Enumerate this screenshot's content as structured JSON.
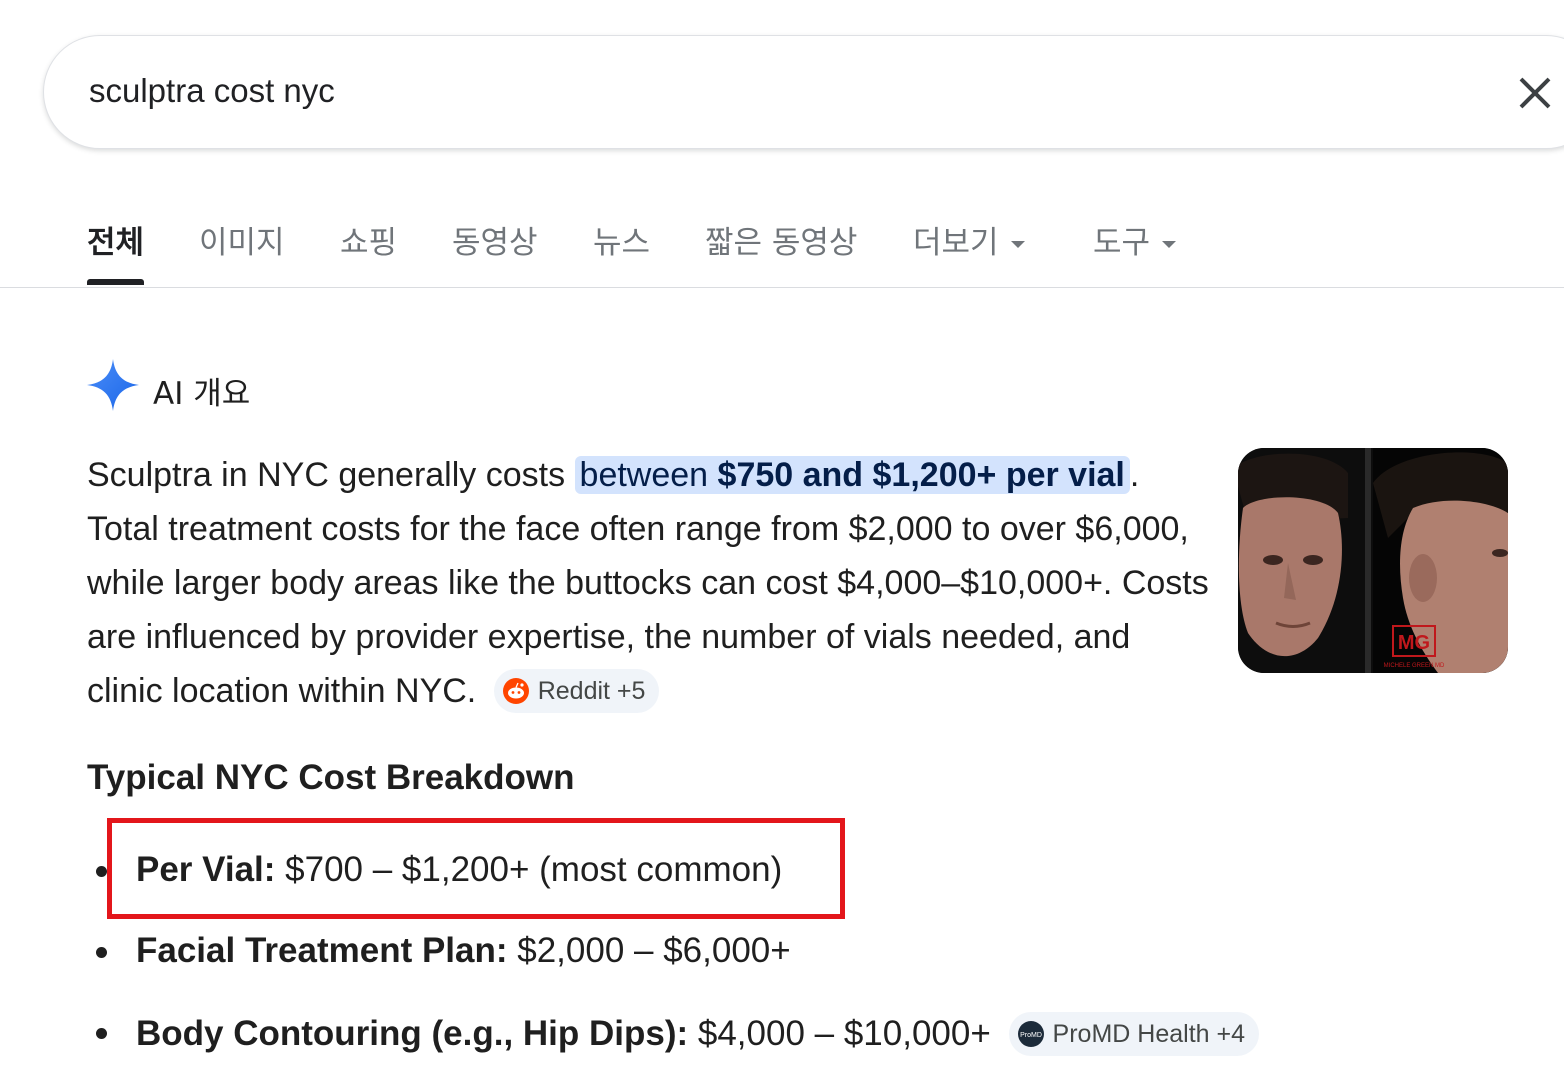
{
  "search": {
    "query": "sculptra cost nyc",
    "clear_label": "×"
  },
  "tabs": [
    {
      "label": "전체",
      "active": true
    },
    {
      "label": "이미지"
    },
    {
      "label": "쇼핑"
    },
    {
      "label": "동영상"
    },
    {
      "label": "뉴스"
    },
    {
      "label": "짧은 동영상"
    },
    {
      "label": "더보기",
      "dropdown": true
    },
    {
      "label": "도구",
      "dropdown": true
    }
  ],
  "ai_overview": {
    "title": "AI 개요",
    "intro_before": "Sculptra in NYC generally costs ",
    "intro_hl_plain": "between ",
    "intro_hl_bold": "$750 and $1,200+ per vial",
    "intro_after": ".",
    "body_rest": "Total treatment costs for the face often range from $2,000 to over $6,000, while larger body areas like the buttocks can cost $4,000–$10,000+. Costs are influenced by provider expertise, the number of vials needed, and clinic location within NYC.",
    "source_chip": "Reddit +5",
    "accent_color": "#4285f4"
  },
  "breakdown": {
    "title": "Typical NYC Cost Breakdown",
    "items": [
      {
        "label": "Per Vial:",
        "value": " $700 – $1,200+ (most common)"
      },
      {
        "label": "Facial Treatment Plan:",
        "value": " $2,000 – $6,000+"
      },
      {
        "label": "Body Contouring (e.g., Hip Dips):",
        "value": " $4,000 – $10,000+"
      }
    ],
    "source_chip": "ProMD Health +4",
    "source_chip_logo": "ProMD"
  },
  "thumbnail": {
    "watermark_text": "MG",
    "watermark_subtext": "MICHELE GREEN MD"
  },
  "colors": {
    "highlight": "#d3e3fd",
    "annotation_box": "#e3161b"
  }
}
